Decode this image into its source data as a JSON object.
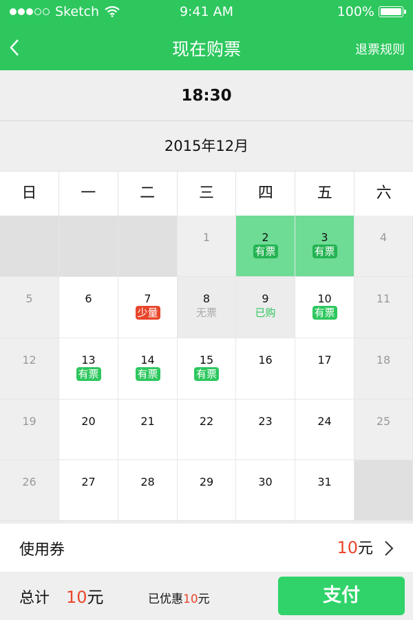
{
  "status_bar": {
    "carrier": "Sketch",
    "time": "9:41 AM",
    "battery": "100%"
  },
  "nav": {
    "title": "现在购票",
    "refund_rules": "退票规则"
  },
  "showtime": "18:30",
  "month": "2015年12月",
  "weekdays": [
    "日",
    "一",
    "二",
    "三",
    "四",
    "五",
    "六"
  ],
  "days": [
    {
      "day": "",
      "status": "empty"
    },
    {
      "day": "",
      "status": "empty"
    },
    {
      "day": "",
      "status": "empty"
    },
    {
      "day": "1",
      "status": "grey"
    },
    {
      "day": "2",
      "status": "lightgreen",
      "badge": "有票",
      "badge_type": "green"
    },
    {
      "day": "3",
      "status": "lightgreen",
      "badge": "有票",
      "badge_type": "green"
    },
    {
      "day": "4",
      "status": "grey"
    },
    {
      "day": "5",
      "status": "grey"
    },
    {
      "day": "6",
      "status": "white"
    },
    {
      "day": "7",
      "status": "white",
      "badge": "少量",
      "badge_type": "red"
    },
    {
      "day": "8",
      "status": "disabled",
      "badge": "无票",
      "badge_type": "grey-text"
    },
    {
      "day": "9",
      "status": "disabled",
      "badge": "已购",
      "badge_type": "green-text"
    },
    {
      "day": "10",
      "status": "white",
      "badge": "有票",
      "badge_type": "green"
    },
    {
      "day": "11",
      "status": "grey"
    },
    {
      "day": "12",
      "status": "grey"
    },
    {
      "day": "13",
      "status": "white",
      "badge": "有票",
      "badge_type": "green"
    },
    {
      "day": "14",
      "status": "white",
      "badge": "有票",
      "badge_type": "green"
    },
    {
      "day": "15",
      "status": "white",
      "badge": "有票",
      "badge_type": "green"
    },
    {
      "day": "16",
      "status": "white"
    },
    {
      "day": "17",
      "status": "white"
    },
    {
      "day": "18",
      "status": "grey"
    },
    {
      "day": "19",
      "status": "grey"
    },
    {
      "day": "20",
      "status": "white"
    },
    {
      "day": "21",
      "status": "white"
    },
    {
      "day": "22",
      "status": "white"
    },
    {
      "day": "23",
      "status": "white"
    },
    {
      "day": "24",
      "status": "white"
    },
    {
      "day": "25",
      "status": "grey"
    },
    {
      "day": "26",
      "status": "grey"
    },
    {
      "day": "27",
      "status": "white"
    },
    {
      "day": "28",
      "status": "white"
    },
    {
      "day": "29",
      "status": "white"
    },
    {
      "day": "30",
      "status": "white"
    },
    {
      "day": "31",
      "status": "white"
    },
    {
      "day": "",
      "status": "empty"
    }
  ],
  "coupon": {
    "label": "使用券",
    "amount": "10",
    "unit": "元"
  },
  "footer": {
    "total_label": "总计",
    "total_amount": "10",
    "total_unit": "元",
    "discount_label": "已优惠",
    "discount_amount": "10",
    "discount_unit": "元",
    "pay_label": "支付"
  },
  "colors": {
    "brand_green": "#2dc75e",
    "accent_red": "#e8462c"
  }
}
